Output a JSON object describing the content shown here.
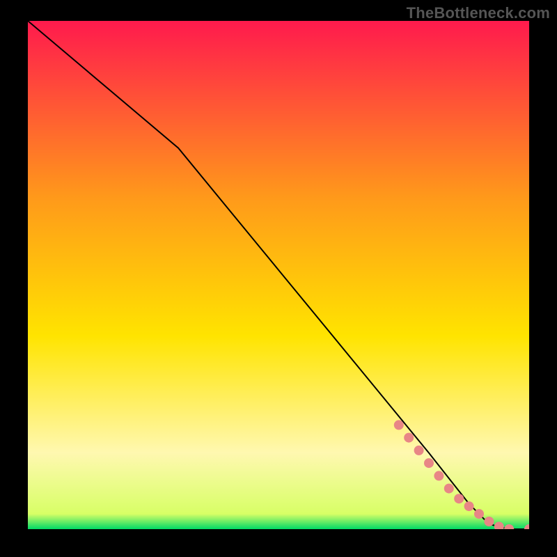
{
  "attribution": "TheBottleneck.com",
  "colors": {
    "frame": "#000000",
    "line": "#000000",
    "marker": "#e88686",
    "grad_top": "#ff1a4d",
    "grad_mid1": "#ff9a1a",
    "grad_mid2": "#ffe400",
    "grad_mid3": "#fff8b0",
    "grad_bottom": "#00d966"
  },
  "chart_data": {
    "type": "line",
    "title": "",
    "xlabel": "",
    "ylabel": "",
    "xlim": [
      0,
      100
    ],
    "ylim": [
      0,
      100
    ],
    "series": [
      {
        "name": "curve",
        "x": [
          0,
          30,
          40,
          50,
          60,
          70,
          80,
          88,
          92,
          96,
          100
        ],
        "y": [
          100,
          75,
          63,
          51,
          39,
          27,
          15,
          5,
          1,
          0,
          0
        ]
      }
    ],
    "markers": {
      "name": "highlight-range",
      "x": [
        74,
        76,
        78,
        80,
        82,
        84,
        86,
        88,
        90,
        92,
        94,
        96,
        100
      ],
      "y": [
        20.5,
        18,
        15.5,
        13,
        10.5,
        8,
        6,
        4.5,
        3,
        1.5,
        0.5,
        0,
        0
      ]
    }
  }
}
